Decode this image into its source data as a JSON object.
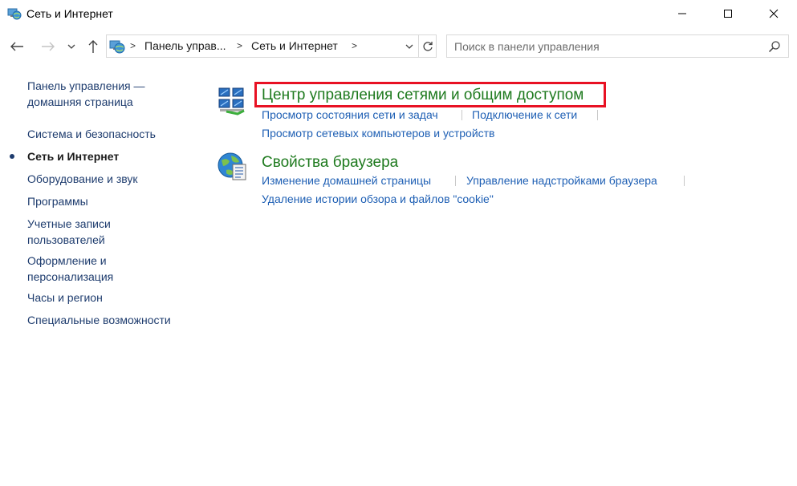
{
  "window": {
    "title": "Сеть и Интернет",
    "icon": "network-globe-icon",
    "controls": [
      "minimize-icon",
      "maximize-icon",
      "close-icon"
    ]
  },
  "nav": {
    "back_icon": "arrow-left-icon",
    "forward_icon": "arrow-right-icon",
    "recent_icon": "chevron-down-icon",
    "up_icon": "arrow-up-icon"
  },
  "address": {
    "crumbs": [
      "Панель управ...",
      "Сеть и Интернет"
    ],
    "separator": ">"
  },
  "search": {
    "placeholder": "Поиск в панели управления"
  },
  "sidebar": {
    "items": [
      {
        "label": "Панель управления —\nдомашняя страница",
        "lines": [
          "Панель управления —",
          "домашняя страница"
        ]
      },
      {
        "label": "Система и безопасность"
      },
      {
        "label": "Сеть и Интернет",
        "active": true
      },
      {
        "label": "Оборудование и звук"
      },
      {
        "label": "Программы"
      },
      {
        "lines": [
          "Учетные записи",
          "пользователей"
        ]
      },
      {
        "lines": [
          "Оформление и",
          "персонализация"
        ]
      },
      {
        "label": "Часы и регион"
      },
      {
        "label": "Специальные возможности"
      }
    ]
  },
  "categories": [
    {
      "title": "Центр управления сетями и общим доступом",
      "icon": "network-center-icon",
      "links": [
        "Просмотр состояния сети и задач",
        "Подключение к сети",
        "Просмотр сетевых компьютеров и устройств"
      ]
    },
    {
      "title": "Свойства браузера",
      "icon": "internet-options-icon",
      "links": [
        "Изменение домашней страницы",
        "Управление надстройками браузера",
        "Удаление истории обзора и файлов \"cookie\""
      ]
    }
  ],
  "colors": {
    "category_title": "#1e7a1e",
    "link": "#1e5fb4",
    "sidebar_link": "#1e3c6e",
    "highlight": "#e81123"
  }
}
